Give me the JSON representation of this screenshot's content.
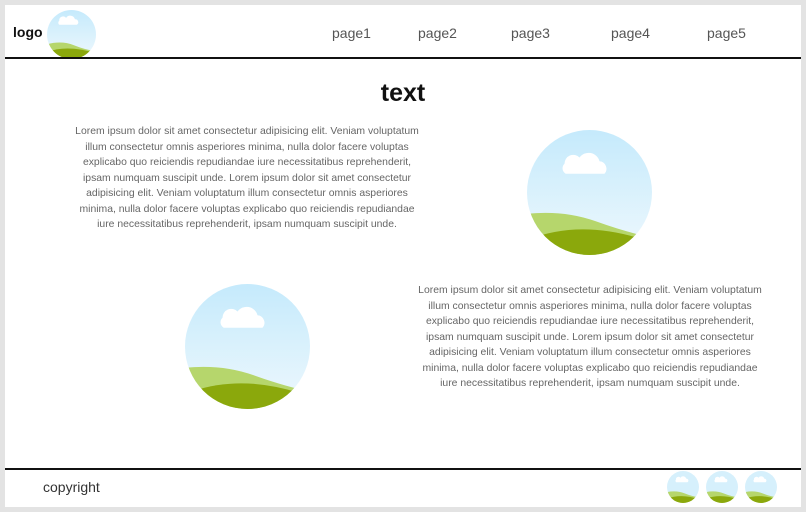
{
  "header": {
    "logo_text": "logo",
    "nav": [
      "page1",
      "page2",
      "page3",
      "page4",
      "page5"
    ]
  },
  "main": {
    "title": "text",
    "paragraph_1": "Lorem ipsum dolor sit amet consectetur adipisicing elit. Veniam voluptatum illum consectetur omnis asperiores minima, nulla dolor facere voluptas explicabo quo reiciendis repudiandae iure necessitatibus reprehenderit, ipsam numquam suscipit unde. Lorem ipsum dolor sit amet consectetur adipisicing elit. Veniam voluptatum illum consectetur omnis asperiores minima, nulla dolor facere voluptas explicabo quo reiciendis repudiandae iure necessitatibus reprehenderit, ipsam numquam suscipit unde.",
    "paragraph_2": "Lorem ipsum dolor sit amet consectetur adipisicing elit. Veniam voluptatum illum consectetur omnis asperiores minima, nulla dolor facere voluptas explicabo quo reiciendis repudiandae iure necessitatibus reprehenderit, ipsam numquam suscipit unde. Lorem ipsum dolor sit amet consectetur adipisicing elit. Veniam voluptatum illum consectetur omnis asperiores minima, nulla dolor facere voluptas explicabo quo reiciendis repudiandae iure necessitatibus reprehenderit, ipsam numquam suscipit unde."
  },
  "footer": {
    "copyright": "copyright"
  },
  "icons": {
    "placeholder_image": "landscape-image-icon"
  },
  "colors": {
    "sky_top": "#c9ecfc",
    "sky_bottom": "#eaf7fd",
    "hill_light": "#b4d56a",
    "hill_dark": "#8aa80c",
    "divider": "#111111"
  }
}
